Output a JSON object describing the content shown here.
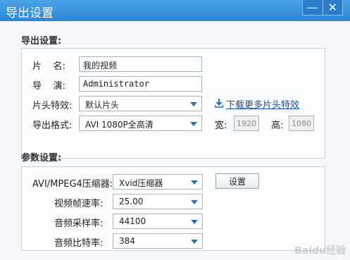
{
  "window": {
    "title": "导出设置",
    "minimize_icon": "minimize-icon",
    "close_icon": "close-icon"
  },
  "export_section": {
    "title": "导出设置:",
    "name_label": "片    名:",
    "name_value": "我的视频",
    "director_label": "导    演:",
    "director_value": "Administrator",
    "opening_label": "片头特效:",
    "opening_value": "默认片头",
    "download_link": "下载更多片头特效",
    "format_label": "导出格式:",
    "format_value": "AVI 1080P全高清",
    "width_label": "宽:",
    "width_value": "1920",
    "height_label": "高:",
    "height_value": "1080"
  },
  "param_section": {
    "title": "参数设置:",
    "codec_label": "AVI/MPEG4压缩器:",
    "codec_value": "Xvid压缩器",
    "settings_button": "设置",
    "framerate_label": "视频帧速率:",
    "framerate_value": "25.00",
    "samplerate_label": "音频采样率:",
    "samplerate_value": "44100",
    "bitrate_label": "音频比特率:",
    "bitrate_value": "384"
  },
  "watermark": "Baidu经验",
  "colors": {
    "titlebar": "#2b86d4",
    "link": "#1a4fa0",
    "arrow": "#2a6fbd"
  }
}
